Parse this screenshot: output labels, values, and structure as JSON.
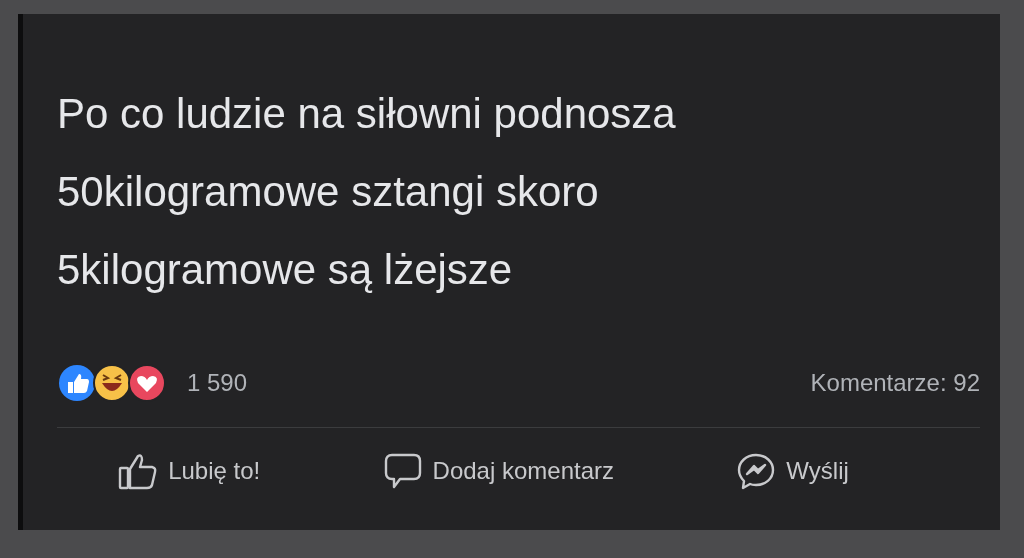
{
  "post": {
    "text_lines": [
      "Po co ludzie na siłowni podnosza",
      "50kilogramowe sztangi skoro",
      "5kilogramowe są lżejsze"
    ],
    "reactions_count": "1 590",
    "comments_count": "Komentarze: 92",
    "actions": [
      {
        "kind": "like",
        "label": "Lubię to!"
      },
      {
        "kind": "comment",
        "label": "Dodaj komentarz"
      },
      {
        "kind": "send",
        "label": "Wyślij"
      }
    ]
  }
}
